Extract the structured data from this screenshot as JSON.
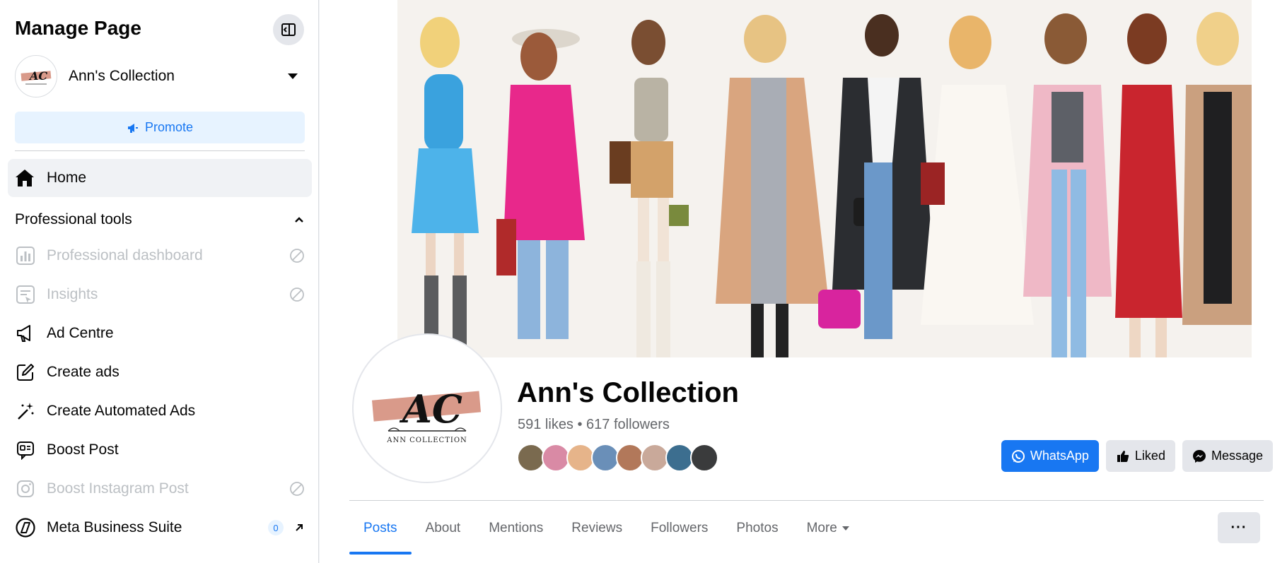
{
  "sidebar": {
    "title": "Manage Page",
    "page_switcher": {
      "name": "Ann's Collection"
    },
    "promote_label": "Promote",
    "home_label": "Home",
    "section": {
      "label": "Professional tools"
    },
    "items": [
      {
        "label": "Professional dashboard",
        "icon": "dashboard-icon",
        "disabled": true
      },
      {
        "label": "Insights",
        "icon": "insights-icon",
        "disabled": true
      },
      {
        "label": "Ad Centre",
        "icon": "megaphone-icon",
        "disabled": false
      },
      {
        "label": "Create ads",
        "icon": "pencil-icon",
        "disabled": false
      },
      {
        "label": "Create Automated Ads",
        "icon": "magic-wand-icon",
        "disabled": false
      },
      {
        "label": "Boost Post",
        "icon": "boost-post-icon",
        "disabled": false
      },
      {
        "label": "Boost Instagram Post",
        "icon": "instagram-icon",
        "disabled": true
      },
      {
        "label": "Meta Business Suite",
        "icon": "business-suite-icon",
        "disabled": false,
        "badge": "0"
      }
    ]
  },
  "logo": {
    "text": "AC",
    "subtext": "ANN COLLECTION"
  },
  "profile": {
    "name": "Ann's Collection",
    "stats": "591 likes • 617 followers"
  },
  "actions": {
    "whatsapp": "WhatsApp",
    "liked": "Liked",
    "message": "Message"
  },
  "tabs": [
    "Posts",
    "About",
    "Mentions",
    "Reviews",
    "Followers",
    "Photos",
    "More"
  ],
  "colors": {
    "accent": "#1877f2",
    "muted": "#65676b",
    "disabled": "#bcc0c4"
  }
}
